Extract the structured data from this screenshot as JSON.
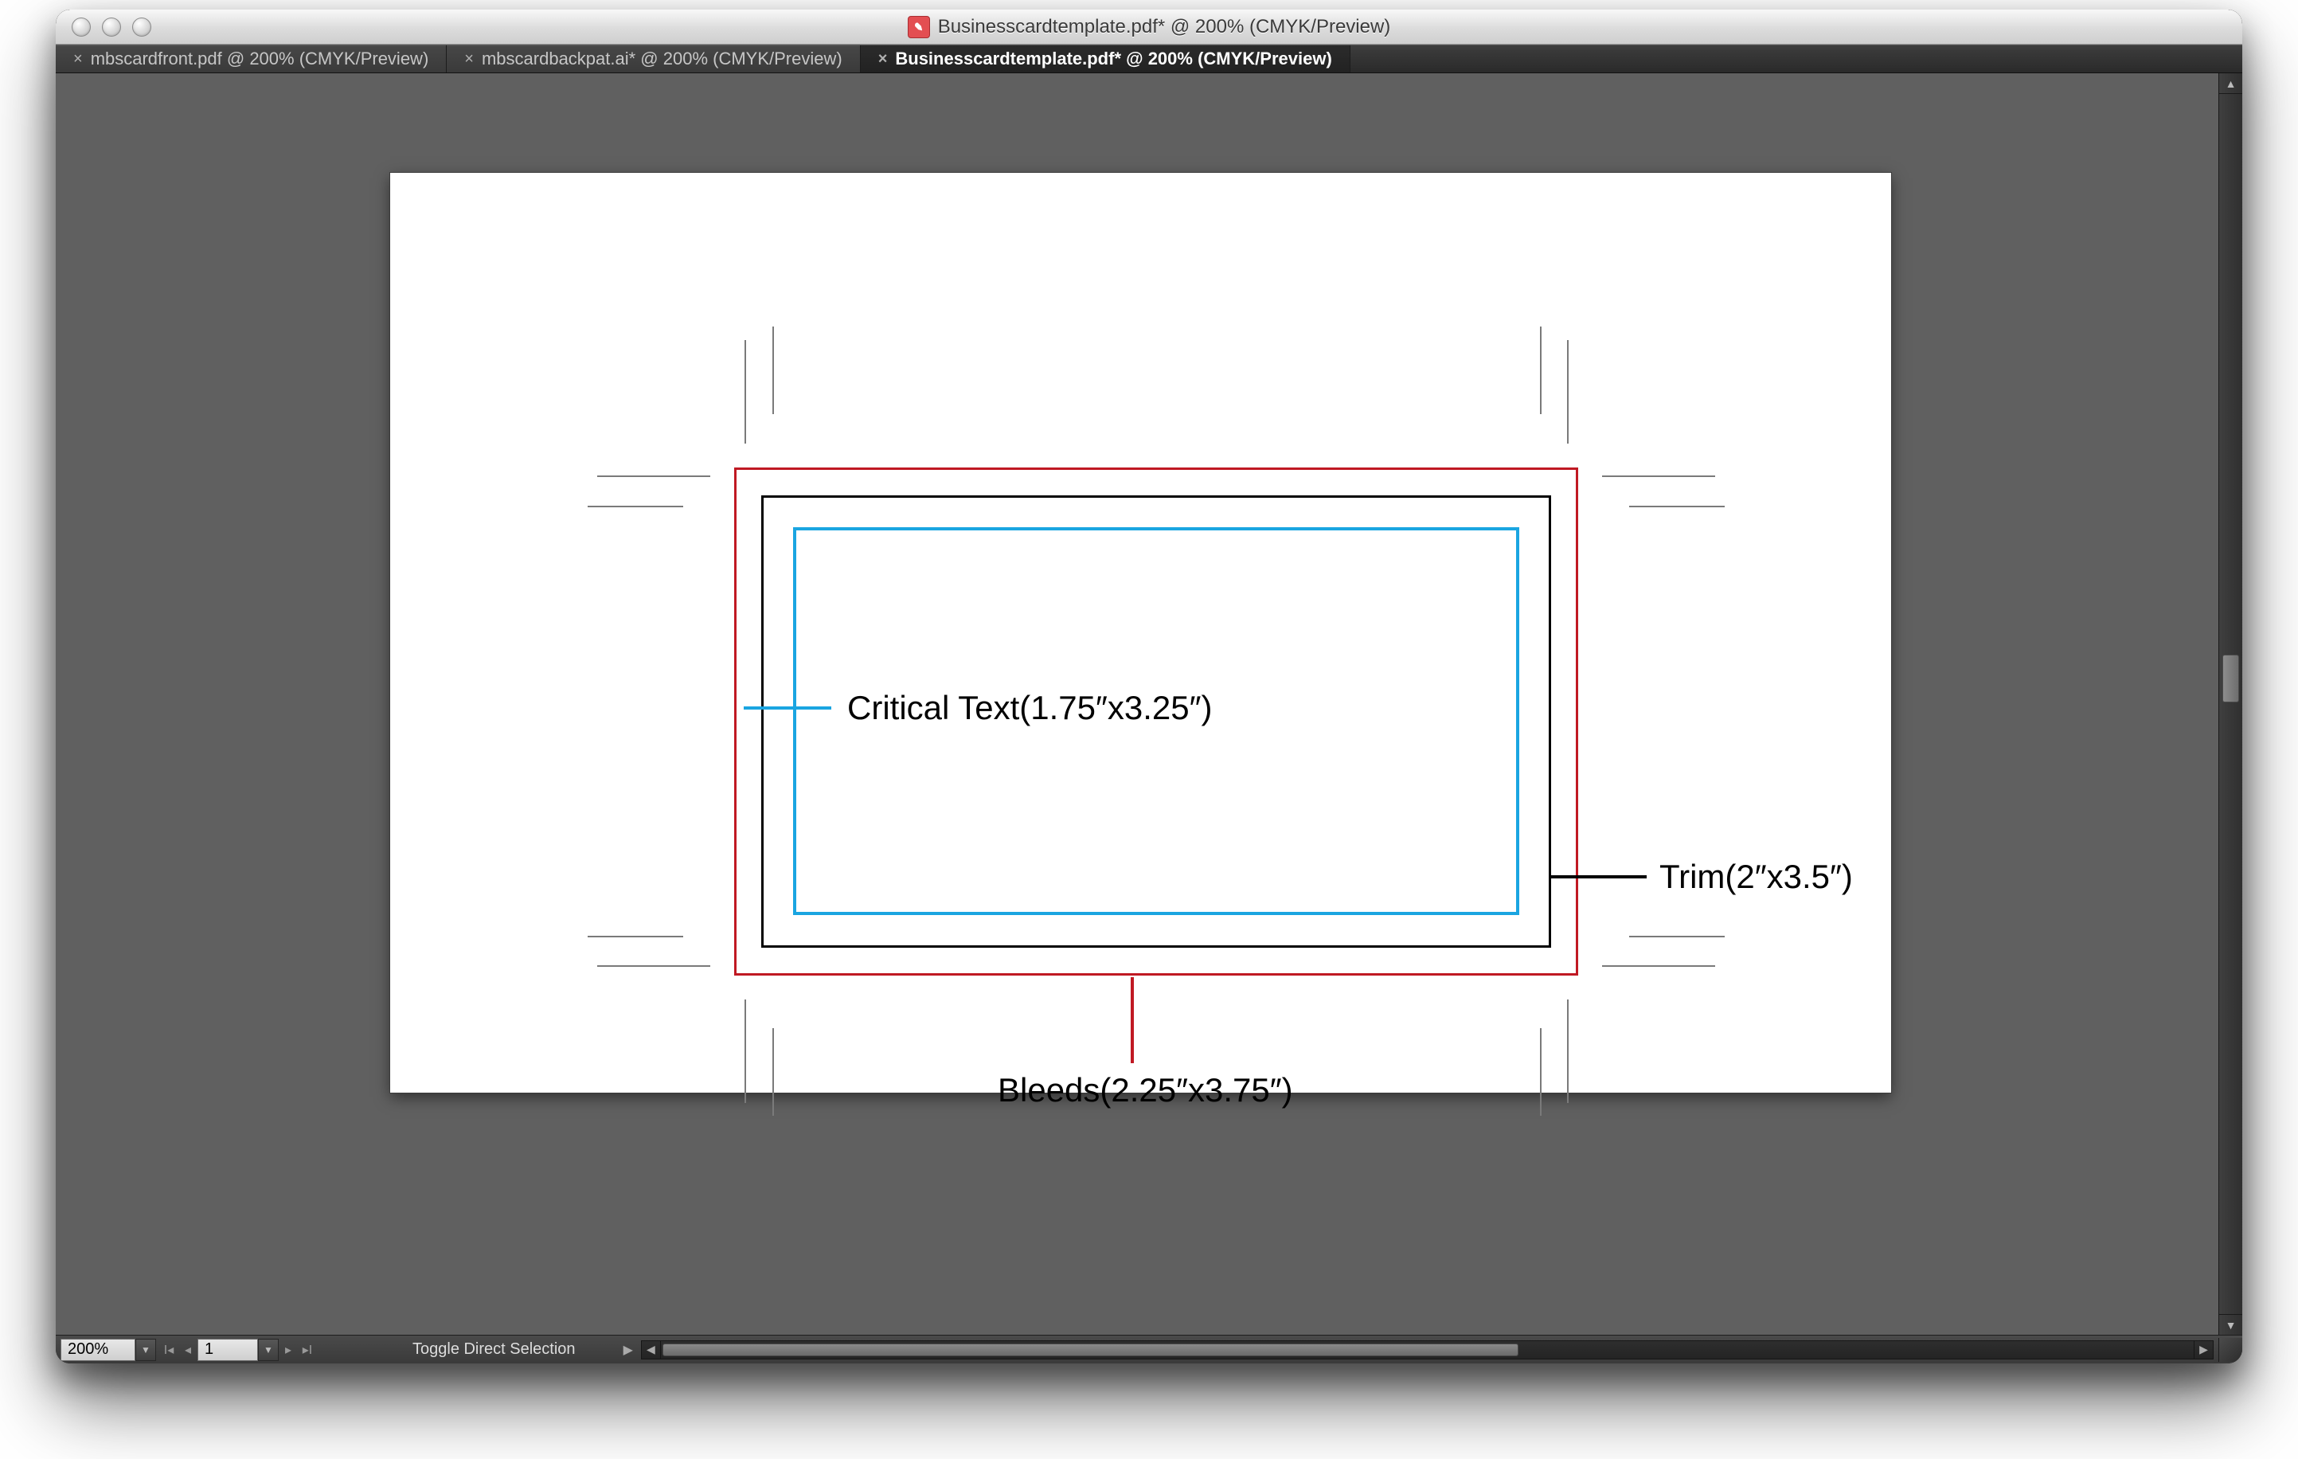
{
  "window": {
    "title": "Businesscardtemplate.pdf* @ 200% (CMYK/Preview)"
  },
  "tabs": [
    {
      "label": "mbscardfront.pdf @ 200% (CMYK/Preview)",
      "active": false
    },
    {
      "label": "mbscardbackpat.ai* @ 200% (CMYK/Preview)",
      "active": false
    },
    {
      "label": "Businesscardtemplate.pdf* @ 200% (CMYK/Preview)",
      "active": true
    }
  ],
  "guides": {
    "critical_label": "Critical Text(1.75″x3.25″)",
    "trim_label": "Trim(2″x3.5″)",
    "bleeds_label": "Bleeds(2.25″x3.75″)",
    "colors": {
      "bleed": "#c01923",
      "trim": "#000000",
      "critical": "#1aa5e1"
    }
  },
  "status": {
    "zoom": "200%",
    "page": "1",
    "hint": "Toggle Direct Selection"
  }
}
